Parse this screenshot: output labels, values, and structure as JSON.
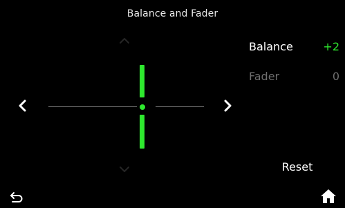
{
  "header": {
    "title": "Balance and Fader"
  },
  "pad": {
    "balance_value": 2,
    "fader_value": 0,
    "accent_color": "#2ee82e"
  },
  "settings": {
    "balance": {
      "label": "Balance",
      "value": "+2"
    },
    "fader": {
      "label": "Fader",
      "value": "0"
    }
  },
  "actions": {
    "reset_label": "Reset"
  },
  "footer": {
    "back_icon": "back-arrow-icon",
    "home_icon": "home-icon"
  }
}
